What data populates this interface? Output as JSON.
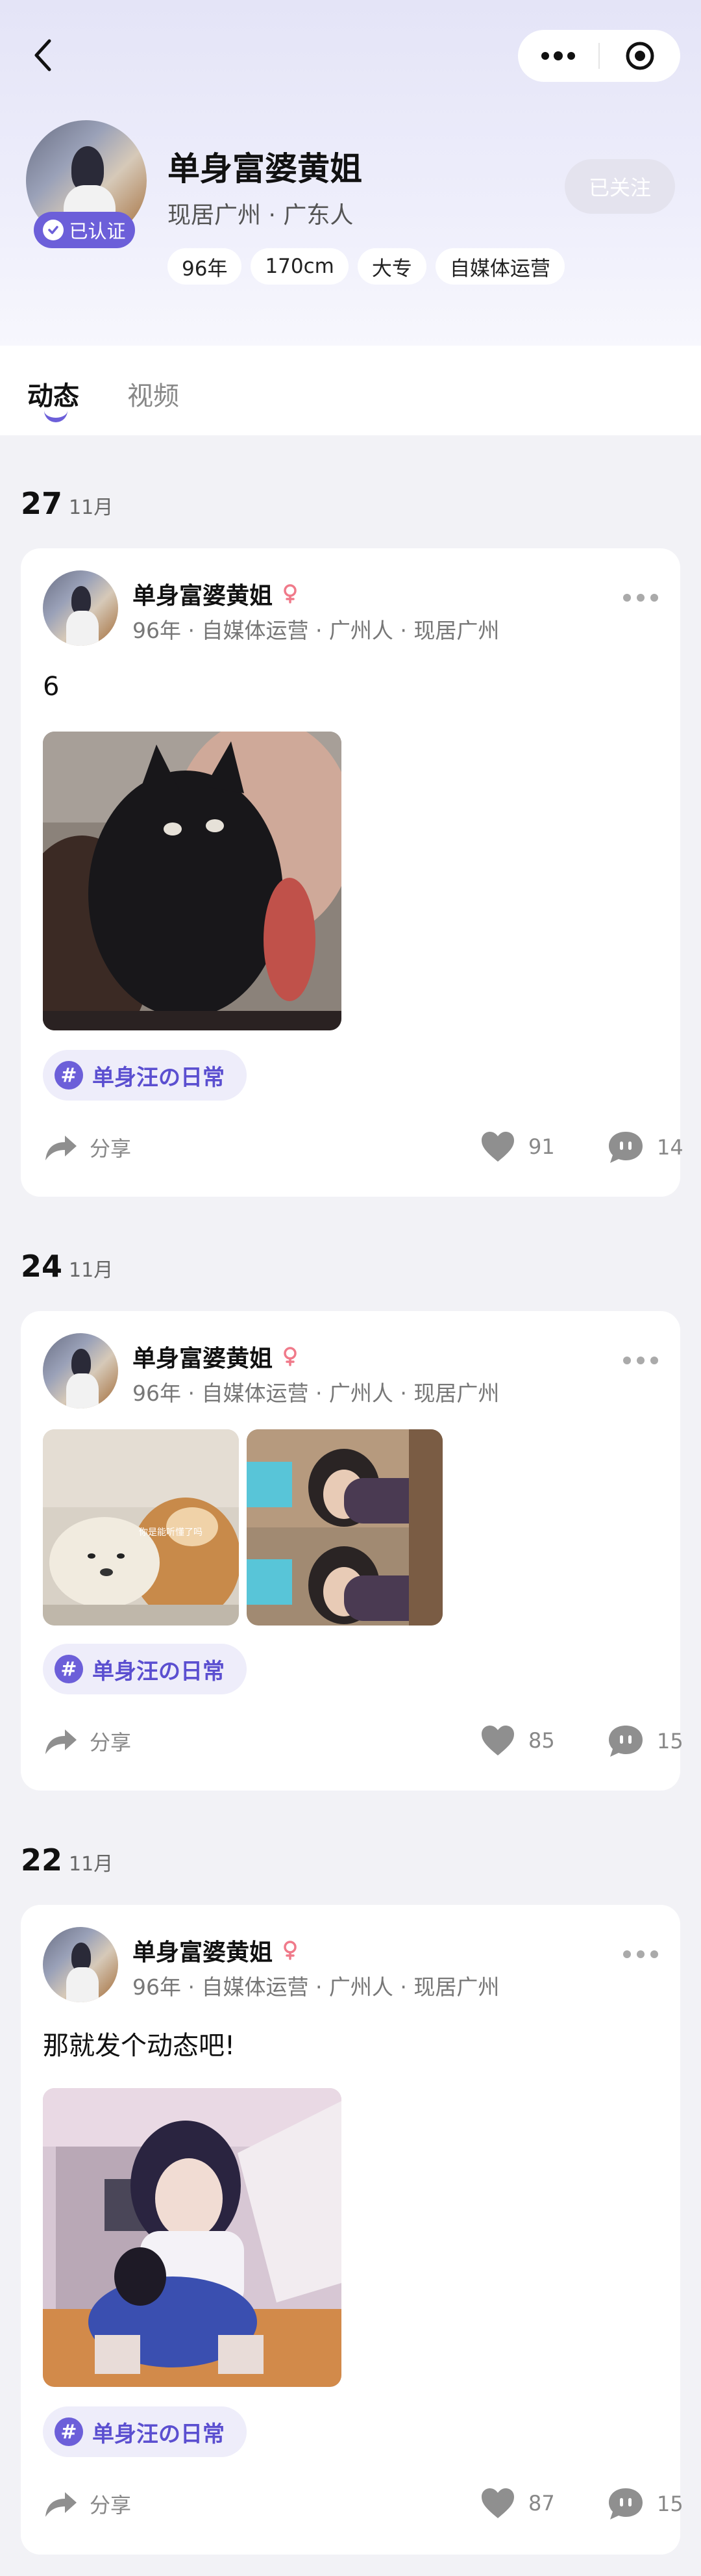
{
  "profile": {
    "name": "单身富婆黄姐",
    "location": "现居广州 · 广东人",
    "verified_label": "已认证",
    "follow_label": "已关注",
    "tags": [
      "96年",
      "170cm",
      "大专",
      "自媒体运营"
    ]
  },
  "tabs": [
    {
      "label": "动态",
      "active": true
    },
    {
      "label": "视频",
      "active": false
    }
  ],
  "posts": [
    {
      "day": "27",
      "month": "11月",
      "author": "单身富婆黄姐",
      "meta": "96年 · 自媒体运营 · 广州人 · 现居广州",
      "text": "6",
      "topic": "单身汪の日常",
      "share_label": "分享",
      "likes": "91",
      "comments": "14"
    },
    {
      "day": "24",
      "month": "11月",
      "author": "单身富婆黄姐",
      "meta": "96年 · 自媒体运营 · 广州人 · 现居广州",
      "text": "",
      "meme_caption": "你是能听懂了吗",
      "topic": "单身汪の日常",
      "share_label": "分享",
      "likes": "85",
      "comments": "15"
    },
    {
      "day": "22",
      "month": "11月",
      "author": "单身富婆黄姐",
      "meta": "96年 · 自媒体运营 · 广州人 · 现居广州",
      "text": "那就发个动态吧!",
      "topic": "单身汪の日常",
      "share_label": "分享",
      "likes": "87",
      "comments": "15"
    }
  ],
  "colors": {
    "accent": "#6c5fd9",
    "topic_bg": "#eeedfa",
    "page_bg": "#f2f2f6"
  }
}
